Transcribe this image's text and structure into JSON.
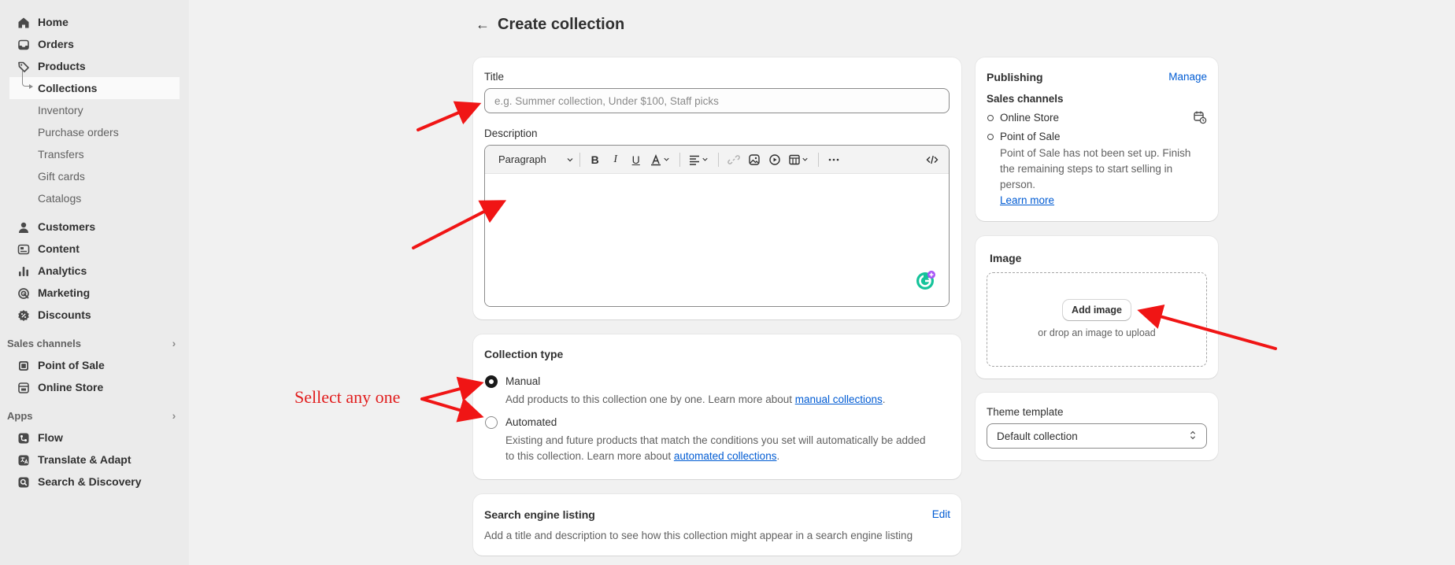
{
  "sidebar": {
    "items": [
      {
        "label": "Home",
        "icon": "home-icon"
      },
      {
        "label": "Orders",
        "icon": "inbox-icon"
      },
      {
        "label": "Products",
        "icon": "tag-icon"
      }
    ],
    "product_subitems": [
      {
        "label": "Collections",
        "active": true
      },
      {
        "label": "Inventory"
      },
      {
        "label": "Purchase orders"
      },
      {
        "label": "Transfers"
      },
      {
        "label": "Gift cards"
      },
      {
        "label": "Catalogs"
      }
    ],
    "items2": [
      {
        "label": "Customers",
        "icon": "person-icon"
      },
      {
        "label": "Content",
        "icon": "content-icon"
      },
      {
        "label": "Analytics",
        "icon": "bar-chart-icon"
      },
      {
        "label": "Marketing",
        "icon": "target-icon"
      },
      {
        "label": "Discounts",
        "icon": "discount-icon"
      }
    ],
    "sales_channels": {
      "header": "Sales channels",
      "items": [
        {
          "label": "Point of Sale",
          "icon": "pos-icon"
        },
        {
          "label": "Online Store",
          "icon": "store-icon"
        }
      ]
    },
    "apps": {
      "header": "Apps",
      "items": [
        {
          "label": "Flow",
          "icon": "flow-icon"
        },
        {
          "label": "Translate & Adapt",
          "icon": "translate-icon"
        },
        {
          "label": "Search & Discovery",
          "icon": "search-discovery-icon"
        }
      ]
    }
  },
  "page": {
    "title": "Create collection"
  },
  "title_card": {
    "title_label": "Title",
    "title_placeholder": "e.g. Summer collection, Under $100, Staff picks",
    "description_label": "Description",
    "paragraph_select": "Paragraph"
  },
  "collection_type": {
    "heading": "Collection type",
    "manual": {
      "label": "Manual",
      "help_prefix": "Add products to this collection one by one. Learn more about ",
      "help_link": "manual collections",
      "help_suffix": "."
    },
    "automated": {
      "label": "Automated",
      "help_line1": "Existing and future products that match the conditions you set will automatically be added",
      "help_prefix": "to this collection. Learn more about ",
      "help_link": "automated collections",
      "help_suffix": "."
    }
  },
  "seo": {
    "heading": "Search engine listing",
    "action": "Edit",
    "help": "Add a title and description to see how this collection might appear in a search engine listing"
  },
  "publishing": {
    "heading": "Publishing",
    "action": "Manage",
    "subheading": "Sales channels",
    "channel1": "Online Store",
    "channel2": "Point of Sale",
    "pos_note_line1": "Point of Sale has not been set up. Finish",
    "pos_note_line2": "the remaining steps to start selling in",
    "pos_note_line3": "person.",
    "learn_more": "Learn more"
  },
  "image": {
    "heading": "Image",
    "button": "Add image",
    "hint": "or drop an image to upload"
  },
  "theme_template": {
    "label": "Theme template",
    "value": "Default collection"
  },
  "annotation": {
    "text": "Sellect any one",
    "color": "#e11d1d"
  }
}
